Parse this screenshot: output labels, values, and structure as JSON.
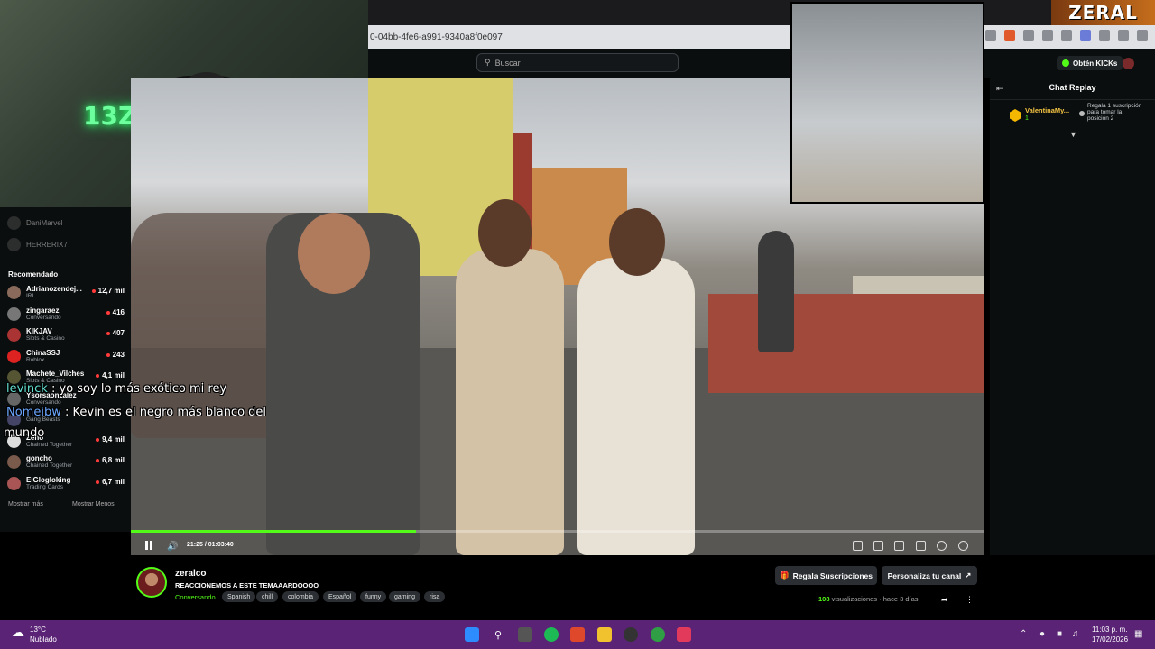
{
  "browser": {
    "address": "0-04bb-4fe6-a991-9340a8f0e097"
  },
  "header": {
    "search_placeholder": "Buscar",
    "get_kicks": "Obtén KICKs"
  },
  "banner": {
    "text": "ZERAL"
  },
  "webcam": {
    "neon_text": "13ZE AL O"
  },
  "sidebar": {
    "following": [
      {
        "name": "DaniMarvel"
      },
      {
        "name": "HERRERIX7"
      }
    ],
    "recommended_title": "Recomendado",
    "recommended": [
      {
        "name": "Adrianozendej...",
        "category": "IRL",
        "viewers": "12,7 mil"
      },
      {
        "name": "zingaraez",
        "category": "Conversando",
        "viewers": "416"
      },
      {
        "name": "KIKJAV",
        "category": "Slots & Casino",
        "viewers": "407"
      },
      {
        "name": "ChinaSSJ",
        "category": "Roblox",
        "viewers": "243"
      },
      {
        "name": "Machete_Vilches",
        "category": "Slots & Casino",
        "viewers": "4,1 mil"
      },
      {
        "name": "Ysorsaonzalez",
        "category": "Conversando",
        "viewers": ""
      },
      {
        "name": "",
        "category": "Gang Beasts",
        "viewers": ""
      },
      {
        "name": "Zeno",
        "category": "Chained Together",
        "viewers": "9,4 mil"
      },
      {
        "name": "goncho",
        "category": "Chained Together",
        "viewers": "6,8 mil"
      },
      {
        "name": "ElGlogloking",
        "category": "Trading Cards",
        "viewers": "6,7 mil"
      }
    ],
    "show_more": "Mostrar más",
    "show_less": "Mostrar Menos"
  },
  "overlay_chat": [
    {
      "user": "levinck",
      "message": ": yo soy lo más exótico mi rey"
    },
    {
      "user": "Nomeibw",
      "message": ": Kevin es el negro más blanco del"
    },
    {
      "user": "",
      "message": "mundo"
    }
  ],
  "player": {
    "time": "21:25 / 01:03:40",
    "progress": 0.334
  },
  "chat": {
    "title": "Chat Replay",
    "gift_user": "ValentinaMy...",
    "gift_count": "1",
    "gift_text": "Regala 1 suscripción para tomar la posición 2"
  },
  "stream": {
    "streamer": "zeralco",
    "title": "REACCIONEMOS A ESTE TEMAAARDOOOO",
    "category": "Conversando",
    "tags": [
      "Spanish",
      "chill",
      "colombia",
      "Español",
      "funny",
      "gaming",
      "risa"
    ],
    "gift_subs_button": "Regala Suscripciones",
    "customize_button": "Personaliza tu canal",
    "views_count": "108",
    "views_label": "visualizaciones",
    "age": "hace 3 días"
  },
  "taskbar": {
    "temp": "13°C",
    "weather": "Nublado",
    "time": "11:03 p. m.",
    "date": "17/02/2026"
  },
  "colors": {
    "accent": "#53fc18",
    "taskbar": "#5a2376",
    "background": "#0b0e0f"
  }
}
